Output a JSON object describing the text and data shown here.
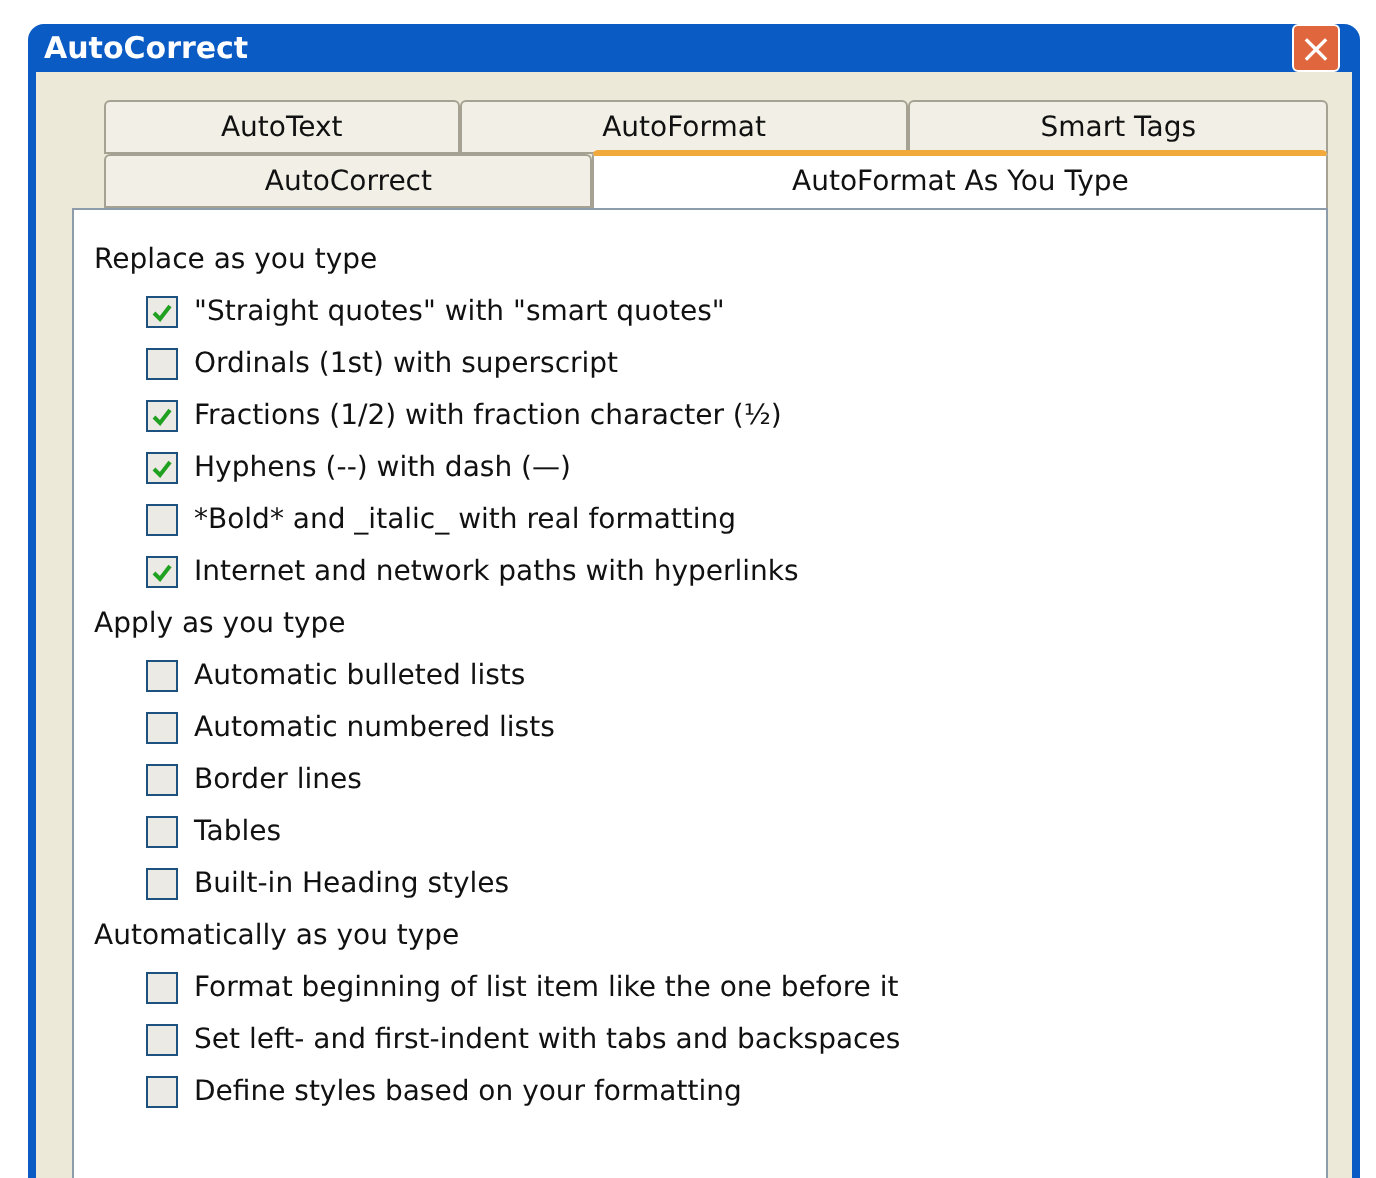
{
  "window": {
    "title": "AutoCorrect",
    "close_button": "×"
  },
  "tab_rows": [
    [
      {
        "label": "AutoText",
        "selected": false
      },
      {
        "label": "AutoFormat",
        "selected": false
      },
      {
        "label": "Smart Tags",
        "selected": false
      }
    ],
    [
      {
        "label": "AutoCorrect",
        "selected": false
      },
      {
        "label": "AutoFormat As You Type",
        "selected": true
      }
    ]
  ],
  "sections": [
    {
      "heading": "Replace as you type",
      "options": [
        {
          "label": "\"Straight quotes\" with \"smart quotes\"",
          "checked": true
        },
        {
          "label": "Ordinals (1st) with superscript",
          "checked": false
        },
        {
          "label": "Fractions (1/2) with fraction character (½)",
          "checked": true
        },
        {
          "label": "Hyphens (--) with dash (—)",
          "checked": true
        },
        {
          "label": "*Bold* and _italic_ with real formatting",
          "checked": false
        },
        {
          "label": "Internet and network paths with hyperlinks",
          "checked": true
        }
      ]
    },
    {
      "heading": "Apply as you type",
      "options": [
        {
          "label": "Automatic bulleted lists",
          "checked": false
        },
        {
          "label": "Automatic numbered lists",
          "checked": false
        },
        {
          "label": "Border lines",
          "checked": false
        },
        {
          "label": "Tables",
          "checked": false
        },
        {
          "label": "Built-in Heading styles",
          "checked": false
        }
      ]
    },
    {
      "heading": "Automatically as you type",
      "options": [
        {
          "label": "Format beginning of list item like the one before it",
          "checked": false
        },
        {
          "label": "Set left- and first-indent with tabs and backspaces",
          "checked": false
        },
        {
          "label": "Define styles based on your formatting",
          "checked": false
        }
      ]
    }
  ]
}
